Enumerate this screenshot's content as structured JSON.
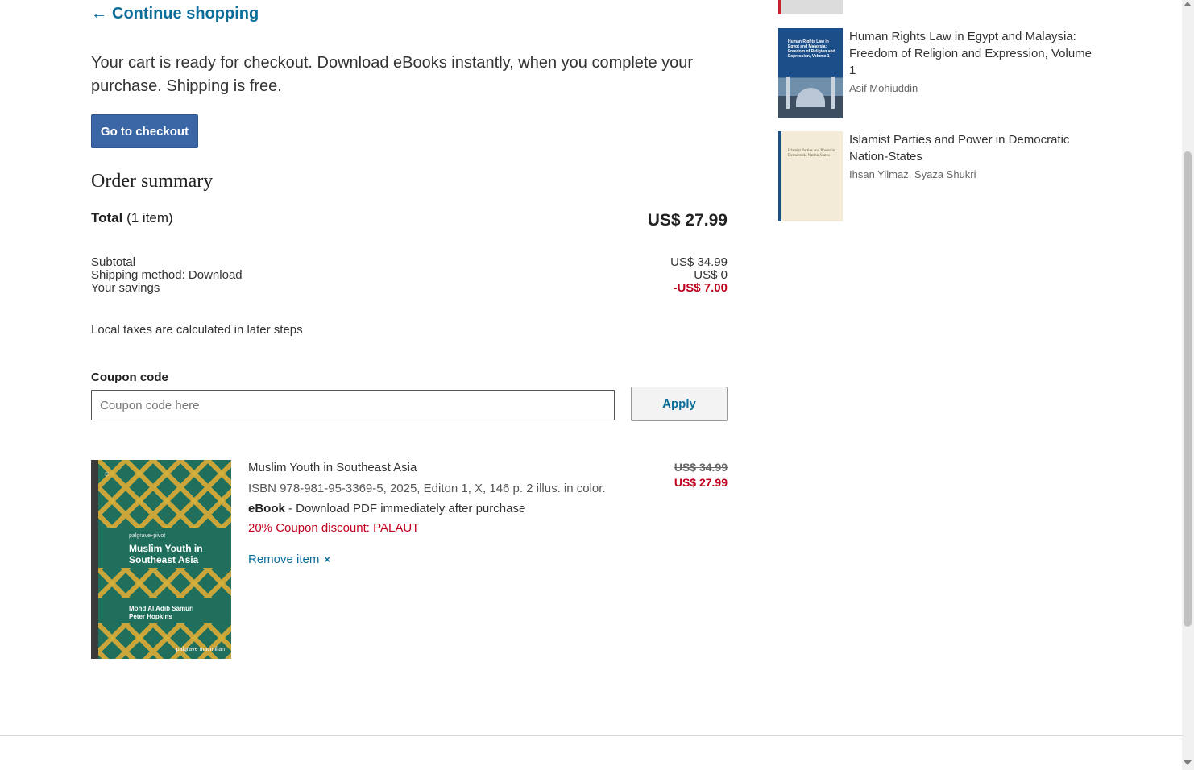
{
  "nav": {
    "continue_arrow": "←",
    "continue_label": "Continue shopping"
  },
  "intro_text": "Your cart is ready for checkout. Download eBooks instantly, when you complete your purchase. Shipping is free.",
  "checkout_button": "Go to checkout",
  "summary": {
    "title": "Order summary",
    "total_label": "Total",
    "total_count": "(1 item)",
    "total_value": "US$ 27.99",
    "rows": [
      {
        "label": "Subtotal",
        "value": "US$ 34.99"
      },
      {
        "label": "Shipping method: Download",
        "value": "US$ 0"
      },
      {
        "label": "Your savings",
        "value": "-US$ 7.00"
      }
    ],
    "taxes_note": "Local taxes are calculated in later steps"
  },
  "coupon": {
    "label": "Coupon code",
    "placeholder": "Coupon code here",
    "value": "",
    "apply_label": "Apply"
  },
  "cart_item": {
    "title": "Muslim Youth in Southeast Asia",
    "details": "ISBN 978-981-95-3369-5, 2025, Editon 1, X, 146 p. 2 illus. in color.",
    "format_name": "eBook",
    "format_desc": " - Download PDF immediately after purchase",
    "coupon_note": "20% Coupon discount: PALAUT",
    "remove_label": "Remove item",
    "remove_icon": "×",
    "price_original": "US$ 34.99",
    "price_discounted": "US$ 27.99",
    "cover": {
      "publisher": "palgrave▸pivot",
      "title": "Muslim Youth in Southeast Asia",
      "authors": "Mohd Al Adib Samuri\nPeter Hopkins",
      "logo": "palgrave macmillan",
      "badge": "☼"
    }
  },
  "recommendations": [
    {
      "title": "Human Rights Law in Egypt and Malaysia: Freedom of Religion and Expression, Volume 1",
      "author": "Asif Mohiuddin",
      "cover_text": "Human Rights Law in Egypt and Malaysia: Freedom of Religion and Expression, Volume 1"
    },
    {
      "title": "Islamist Parties and Power in Democratic Nation-States",
      "author": "Ihsan Yilmaz, Syaza Shukri",
      "cover_text": "Islamist Parties and Power in Democratic Nation-States"
    }
  ],
  "colors": {
    "link": "#0b6e9a",
    "primary_button": "#3a66a6",
    "discount_red": "#c0001d"
  }
}
